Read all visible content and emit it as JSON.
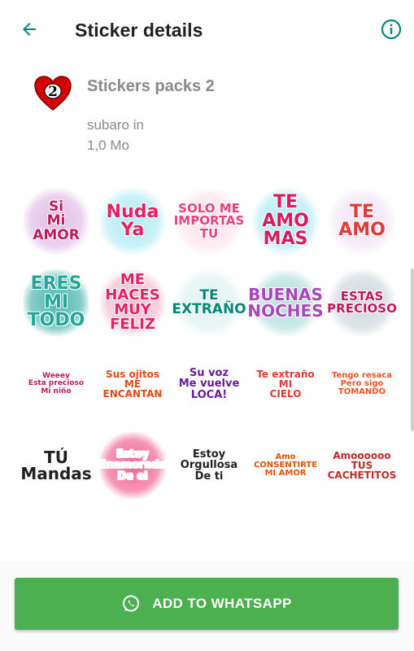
{
  "appbar": {
    "title": "Sticker details"
  },
  "pack": {
    "name": "Stickers packs 2",
    "author": "subaro in",
    "size": "1,0 Mo",
    "tray_number": "2"
  },
  "stickers": [
    {
      "text": "Si\nMi AMOR",
      "color": "#c2185b",
      "bg": "#e1bee7"
    },
    {
      "text": "Nuda\nYa",
      "color": "#e91e63",
      "bg": "#b2ebf2"
    },
    {
      "text": "SOLO ME\nIMPORTAS\nTU",
      "color": "#ec407a",
      "bg": "#fce4ec"
    },
    {
      "text": "TE\nAMO\nMAS",
      "color": "#d81b60",
      "bg": "#b2ebf2"
    },
    {
      "text": "TE\nAMO",
      "color": "#e53935",
      "bg": "#f3e5f5"
    },
    {
      "text": "ERES\nMI\nTODO",
      "color": "#26a69a",
      "bg": "#4db6ac"
    },
    {
      "text": "ME\nHACES\nMUY\nFELIZ",
      "color": "#e91e63",
      "bg": "#f8bbd0"
    },
    {
      "text": "TE\nEXTRAÑO",
      "color": "#00897b",
      "bg": "#e0f2f1"
    },
    {
      "text": "BUENAS\nNOCHES",
      "color": "#ab47bc",
      "bg": "#b2dfdb"
    },
    {
      "text": "ESTAS\nPRECIOSO",
      "color": "#c2185b",
      "bg": "#cfd8dc"
    },
    {
      "text": "Weeey\nEsta precioso\nMi niño",
      "color": "#c2185b",
      "bg": "#ffffff"
    },
    {
      "text": "Sus ojitos\nME\nENCANTAN",
      "color": "#e64a19",
      "bg": "#ffffff"
    },
    {
      "text": "Su voz\nMe vuelve\nLOCA!",
      "color": "#6a1b9a",
      "bg": "#ffffff"
    },
    {
      "text": "Te extraño\nMI\nCIELO",
      "color": "#e53935",
      "bg": "#ffffff"
    },
    {
      "text": "Tengo resaca\nPero sigo\nTOMANDO",
      "color": "#f4511e",
      "bg": "#ffffff"
    },
    {
      "text": "TÚ\nMandas",
      "color": "#212121",
      "bg": "#ffffff"
    },
    {
      "text": "Estoy\nEnamorada\nDe el",
      "color": "#ffffff",
      "bg": "#f06292"
    },
    {
      "text": "Estoy\nOrgullosa\nDe ti",
      "color": "#212121",
      "bg": "#ffffff"
    },
    {
      "text": "Amo\nCONSENTIRTE\nMI AMOR",
      "color": "#e65100",
      "bg": "#ffffff"
    },
    {
      "text": "Amoooooo\nTUS\nCACHETITOS",
      "color": "#c62828",
      "bg": "#ffffff"
    }
  ],
  "footer": {
    "button_label": "ADD TO WHATSAPP"
  },
  "colors": {
    "accent": "#4caf50",
    "icon_teal": "#00897b",
    "text_gray": "#8a8a8a"
  },
  "icons": {
    "back": "arrow-left-icon",
    "info": "info-icon",
    "whatsapp": "whatsapp-icon",
    "tray": "heart-icon"
  }
}
